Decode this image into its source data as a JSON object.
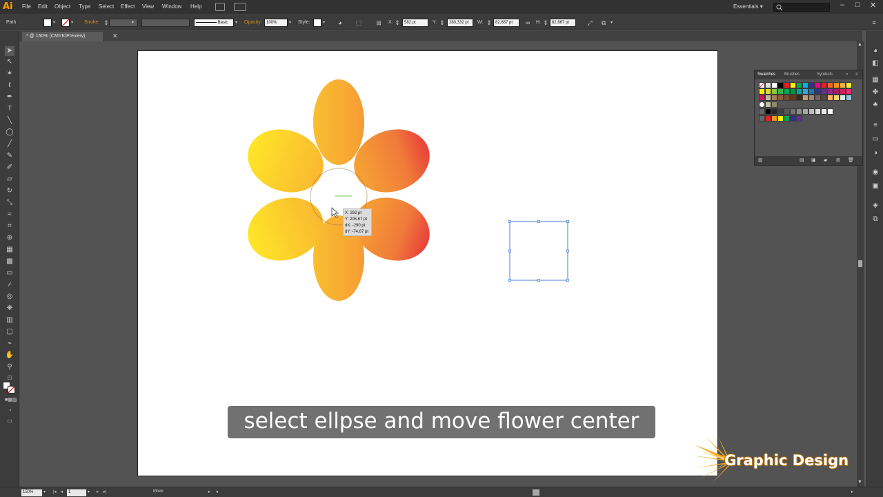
{
  "menubar": {
    "app_logo": "Ai",
    "items": [
      "File",
      "Edit",
      "Object",
      "Type",
      "Select",
      "Effect",
      "View",
      "Window",
      "Help"
    ],
    "workspace": "Essentials",
    "workspace_arrow": "▾",
    "window_buttons": [
      "–",
      "□",
      "✕"
    ]
  },
  "controlbar": {
    "selection_label": "Path",
    "stroke_label": "Stroke:",
    "brush_label": "Basic",
    "opacity_label": "Opacity:",
    "opacity_value": "100%",
    "style_label": "Style:",
    "x_label": "X:",
    "x_value": "582 pt",
    "y_label": "Y:",
    "y_value": "280,332 pt",
    "w_label": "W:",
    "w_value": "82,667 pt",
    "h_label": "H:",
    "h_value": "82,667 pt"
  },
  "tabbar": {
    "doc_tab": "* @ 150% (CMYK/Preview)",
    "close": "✕"
  },
  "readout": {
    "x": "X: 292 pt",
    "y": "Y: 205,67 pt",
    "dx": "dX: -290 pt",
    "dy": "dY: -74,67 pt"
  },
  "swatches": {
    "tabs": [
      "Swatches",
      "Brushes",
      "Symbols"
    ],
    "menu": "≡"
  },
  "statusbar": {
    "zoom": "150%",
    "page": "1",
    "mode": "Move"
  },
  "caption": "select ellpse and move flower center",
  "logo_text": "Graphic Design",
  "colors": {
    "petal_left": "#ffe529",
    "petal_mid": "#f7a833",
    "petal_right": "#e8403a",
    "selection_blue": "#4a7fd1"
  }
}
